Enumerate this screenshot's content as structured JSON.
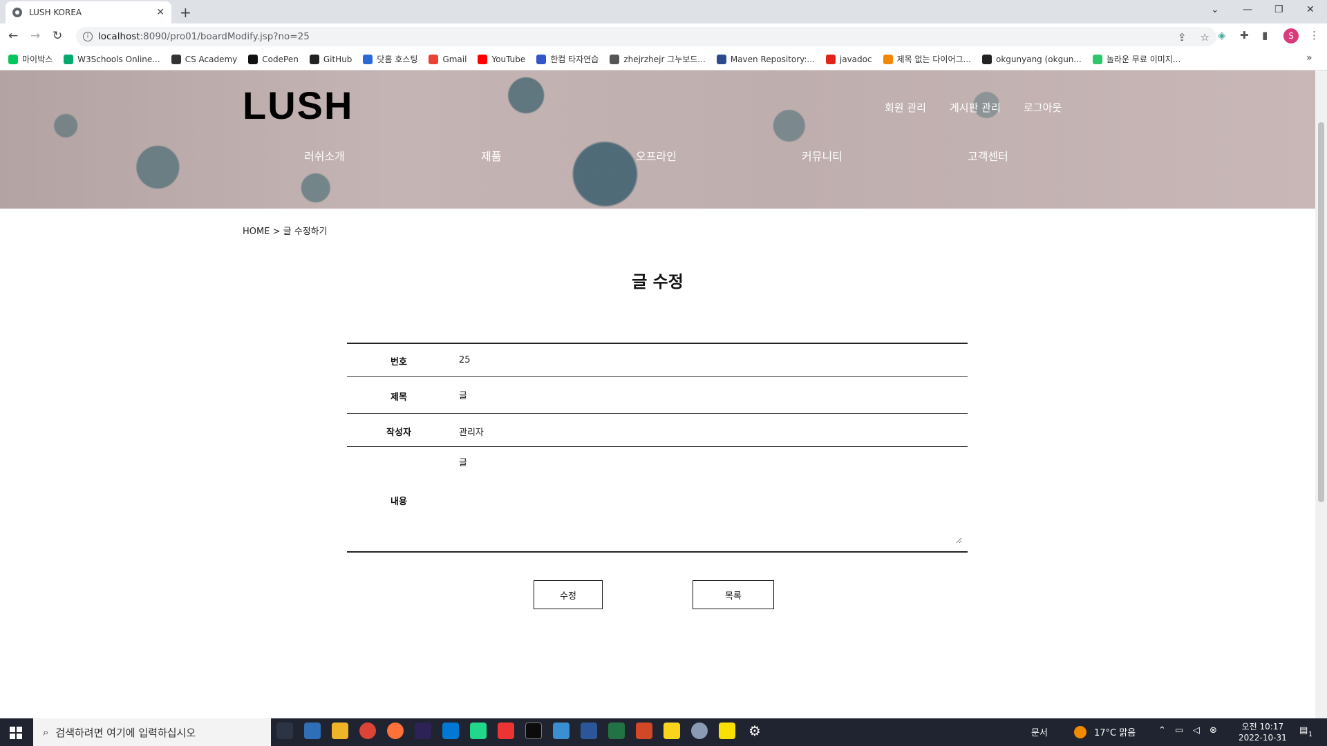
{
  "browser": {
    "tab_title": "LUSH KOREA",
    "url_host": "localhost",
    "url_rest": ":8090/pro01/boardModify.jsp?no=25",
    "bookmarks": [
      {
        "label": "마이박스",
        "icon": "naver-icon",
        "color": "#03c75a"
      },
      {
        "label": "W3Schools Online...",
        "icon": "w3schools-icon",
        "color": "#04aa6d"
      },
      {
        "label": "CS Academy",
        "icon": "cs-academy-icon",
        "color": "#333333"
      },
      {
        "label": "CodePen",
        "icon": "codepen-icon",
        "color": "#111111"
      },
      {
        "label": "GitHub",
        "icon": "github-icon",
        "color": "#222222"
      },
      {
        "label": "닷홈 호스팅",
        "icon": "dothome-icon",
        "color": "#2a6ad6"
      },
      {
        "label": "Gmail",
        "icon": "gmail-icon",
        "color": "#ea4335"
      },
      {
        "label": "YouTube",
        "icon": "youtube-icon",
        "color": "#ff0000"
      },
      {
        "label": "한컴 타자연습",
        "icon": "hancom-icon",
        "color": "#3355cc"
      },
      {
        "label": "zhejrzhejr 그누보드...",
        "icon": "globe-icon",
        "color": "#555555"
      },
      {
        "label": "Maven Repository:...",
        "icon": "maven-icon",
        "color": "#2b4c8c"
      },
      {
        "label": "javadoc",
        "icon": "oracle-icon",
        "color": "#e2231a"
      },
      {
        "label": "제목 없는 다이어그...",
        "icon": "drawio-icon",
        "color": "#f08705"
      },
      {
        "label": "okgunyang (okgun...",
        "icon": "github-icon",
        "color": "#222222"
      },
      {
        "label": "놀라운 무료 이미지...",
        "icon": "pixabay-icon",
        "color": "#2ec66d"
      }
    ]
  },
  "site": {
    "logo": "LUSH",
    "top_menu": [
      "회원 관리",
      "게시판 관리",
      "로그아웃"
    ],
    "main_nav": [
      "러쉬소개",
      "제품",
      "오프라인",
      "커뮤니티",
      "고객센터"
    ]
  },
  "breadcrumb": {
    "home": "HOME",
    "sep": ">",
    "current": "글 수정하기"
  },
  "page_title": "글 수정",
  "form": {
    "no_label": "번호",
    "no_value": "25",
    "title_label": "제목",
    "title_value": "글",
    "author_label": "작성자",
    "author_value": "관리자",
    "content_label": "내용",
    "content_value": "글"
  },
  "buttons": {
    "submit": "수정",
    "list": "목록"
  },
  "taskbar": {
    "search_placeholder": "검색하려면 여기에 입력하십시오",
    "docs": "문서",
    "weather": "17°C 맑음",
    "time": "오전 10:17",
    "date": "2022-10-31",
    "notification_count": "1"
  }
}
